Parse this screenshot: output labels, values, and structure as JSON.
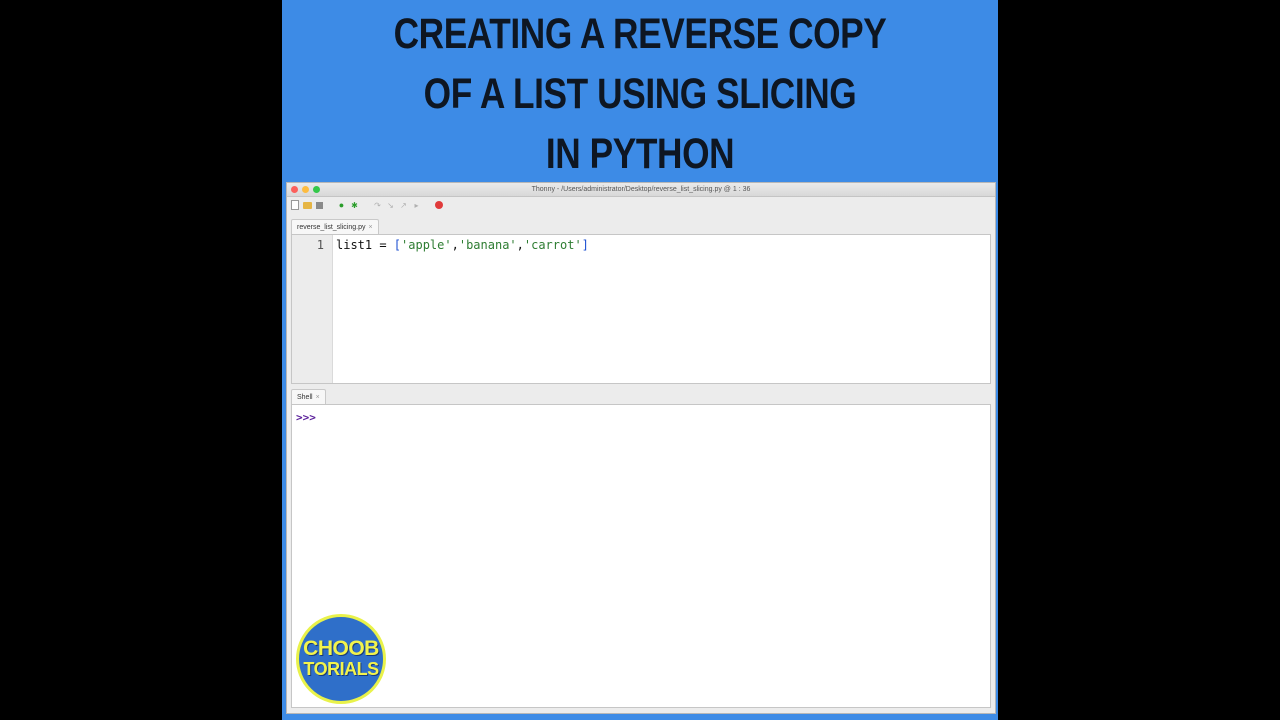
{
  "video": {
    "title_lines": [
      "CREATING A REVERSE COPY",
      "OF A LIST USING SLICING",
      "IN PYTHON"
    ]
  },
  "window": {
    "title": "Thonny  -  /Users/administrator/Desktop/reverse_list_slicing.py  @  1 : 36"
  },
  "editor": {
    "tab_label": "reverse_list_slicing.py",
    "tab_close": "×",
    "line_numbers": [
      "1"
    ],
    "code": {
      "var": "list1 = ",
      "open": "[",
      "s1": "'apple'",
      "c1": ",",
      "s2": "'banana'",
      "c2": ",",
      "s3": "'carrot'",
      "close": "]"
    }
  },
  "shell": {
    "tab_label": "Shell",
    "tab_close": "×",
    "prompt": ">>>"
  },
  "logo": {
    "line1": "CHOOB",
    "line2": "TORIALS"
  },
  "colors": {
    "background_blue": "#3d8be6",
    "string_green": "#2e7d32",
    "prompt_purple": "#5a1f9a"
  }
}
